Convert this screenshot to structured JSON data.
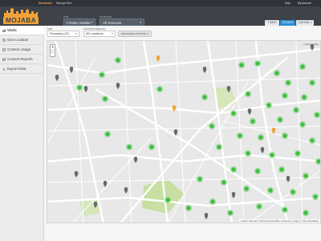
{
  "topbar": {
    "links": [
      "Dashboard",
      "Manage Sites"
    ],
    "right": [
      "Help",
      "My Account"
    ]
  },
  "header": {
    "logo_text": "MOJABA",
    "site_label": "SITE",
    "site_value": "Firstsio Mobile Corporate",
    "sources_label": "SOURCES",
    "sources_value": "All Sources",
    "ranges": [
      "7 DAYS",
      "30 DAYS",
      "CUSTOM"
    ],
    "active_range": "30 DAYS"
  },
  "sidebar": {
    "items": [
      {
        "label": "Visits",
        "icon": "visits-icon"
      },
      {
        "label": "Geo-Location",
        "icon": "globe-icon"
      },
      {
        "label": "Content Usage",
        "icon": "document-icon"
      },
      {
        "label": "Custom Reports",
        "icon": "report-icon"
      },
      {
        "label": "Export Data",
        "icon": "export-icon"
      }
    ],
    "active_index": 0
  },
  "controls": {
    "map_label": "MAP",
    "map_value": "Summary (47)",
    "country_label": "COUNTRY/REGION",
    "country_value": "All Locations",
    "advanced_label": "ADVANCED OPTIONS"
  },
  "map": {
    "zoom_in": "+",
    "zoom_out": "−",
    "expand_label": "Expand Map",
    "attribution": "Leaflet | Map data © 2013 OpenStreetMap contributors, Imagery © 2013 CloudMade",
    "colors": {
      "cluster": "#3fbf3f",
      "pin_gray": "#5f6b6f",
      "pin_orange": "#f0a43c",
      "park": "#c7dfa3",
      "road": "#ffffff"
    }
  }
}
